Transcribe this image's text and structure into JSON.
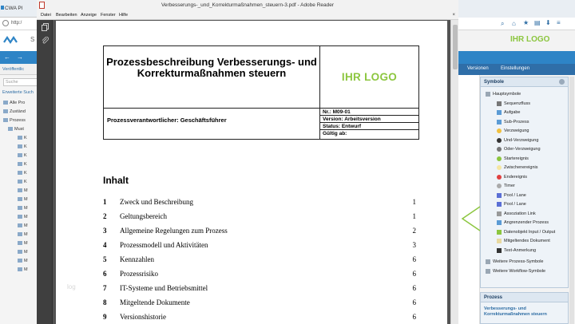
{
  "reader": {
    "window_title": "Verbesserungs-_und_Korrekturmaßnahmen_steuern-3.pdf - Adobe Reader",
    "menu": [
      "Datei",
      "Bearbeiten",
      "Anzeige",
      "Fenster",
      "Hilfe"
    ],
    "close_label": "×"
  },
  "pdf": {
    "header_title": "Prozessbeschreibung Verbesserungs- und Korrekturmaßnahmen steuern",
    "logo": "IHR LOGO",
    "responsible": "Prozessverantwortlicher: Geschäftsführer",
    "meta": {
      "nr": "Nr.: M09-01",
      "version": "Version: Arbeitsversion",
      "status": "Status: Entwurf",
      "valid": "Gültig ab:"
    },
    "toc_heading": "Inhalt",
    "toc": [
      {
        "num": "1",
        "label": "Zweck und Beschreibung",
        "page": "1"
      },
      {
        "num": "2",
        "label": "Geltungsbereich",
        "page": "1"
      },
      {
        "num": "3",
        "label": "Allgemeine Regelungen zum Prozess",
        "page": "2"
      },
      {
        "num": "4",
        "label": "Prozessmodell und Aktivitäten",
        "page": "3"
      },
      {
        "num": "5",
        "label": "Kennzahlen",
        "page": "6"
      },
      {
        "num": "6",
        "label": "Prozessrisiko",
        "page": "6"
      },
      {
        "num": "7",
        "label": "IT-Systeme und Betriebsmittel",
        "page": "6"
      },
      {
        "num": "8",
        "label": "Mitgeltende Dokumente",
        "page": "6"
      },
      {
        "num": "9",
        "label": "Versionshistorie",
        "page": "6"
      }
    ]
  },
  "bg_left": {
    "tab_title": "CWA Pl",
    "address": "http:/",
    "logo_text": "S",
    "tab_label": "Veröffentlic",
    "search_placeholder": "Suche",
    "extended_search": "Erweiterte Such",
    "tree": [
      "Alle Pro",
      "Zuständ",
      "Prozess",
      "Must",
      "K",
      "K",
      "K",
      "K",
      "K",
      "K",
      "M",
      "M",
      "M",
      "M",
      "M",
      "M",
      "M",
      "M",
      "M",
      "M"
    ],
    "overlay_text": "log"
  },
  "bg_right": {
    "logo": "IHR LOGO",
    "tabs": [
      "Versionen",
      "Einstellungen"
    ],
    "symbols_title": "Symbole",
    "symbols": [
      {
        "label": "Hauptsymbole",
        "icon": "folder-icon",
        "indent": 0
      },
      {
        "label": "Sequenzfluss",
        "icon": "arrow-icon",
        "indent": 1
      },
      {
        "label": "Aufgabe",
        "icon": "task-icon",
        "indent": 1
      },
      {
        "label": "Sub-Prozess",
        "icon": "subprocess-icon",
        "indent": 1
      },
      {
        "label": "Verzweigung",
        "icon": "gateway-icon",
        "indent": 1
      },
      {
        "label": "Und-Verzweigung",
        "icon": "and-gateway-icon",
        "indent": 1
      },
      {
        "label": "Oder-Verzweigung",
        "icon": "or-gateway-icon",
        "indent": 1
      },
      {
        "label": "Startereignis",
        "icon": "start-event-icon",
        "indent": 1
      },
      {
        "label": "Zwischenereignis",
        "icon": "intermediate-event-icon",
        "indent": 1
      },
      {
        "label": "Endereignis",
        "icon": "end-event-icon",
        "indent": 1
      },
      {
        "label": "Timer",
        "icon": "timer-icon",
        "indent": 1
      },
      {
        "label": "Pool / Lane",
        "icon": "pool-icon",
        "indent": 1
      },
      {
        "label": "Pool / Lane",
        "icon": "pool-icon",
        "indent": 1
      },
      {
        "label": "Assoziation Link",
        "icon": "link-icon",
        "indent": 1
      },
      {
        "label": "Angrenzender Prozess",
        "icon": "adjacent-process-icon",
        "indent": 1
      },
      {
        "label": "Datenobjekt Input / Output",
        "icon": "data-object-icon",
        "indent": 1
      },
      {
        "label": "Mitgeltendes Dokument",
        "icon": "document-icon",
        "indent": 1
      },
      {
        "label": "Text-Anmerkung",
        "icon": "text-icon",
        "indent": 1
      },
      {
        "label": "Weitere Prozess-Symbole",
        "icon": "folder-icon",
        "indent": 0
      },
      {
        "label": "Weitere Workflow-Symbole",
        "icon": "folder-icon",
        "indent": 0
      }
    ],
    "process_title": "Prozess",
    "process_name": "Verbesserungs- und Korrekturmaßnahmen steuern"
  },
  "colors": {
    "logo_green": "#8cc63f",
    "brand_blue": "#2e84c6",
    "reader_bg": "#535353"
  }
}
